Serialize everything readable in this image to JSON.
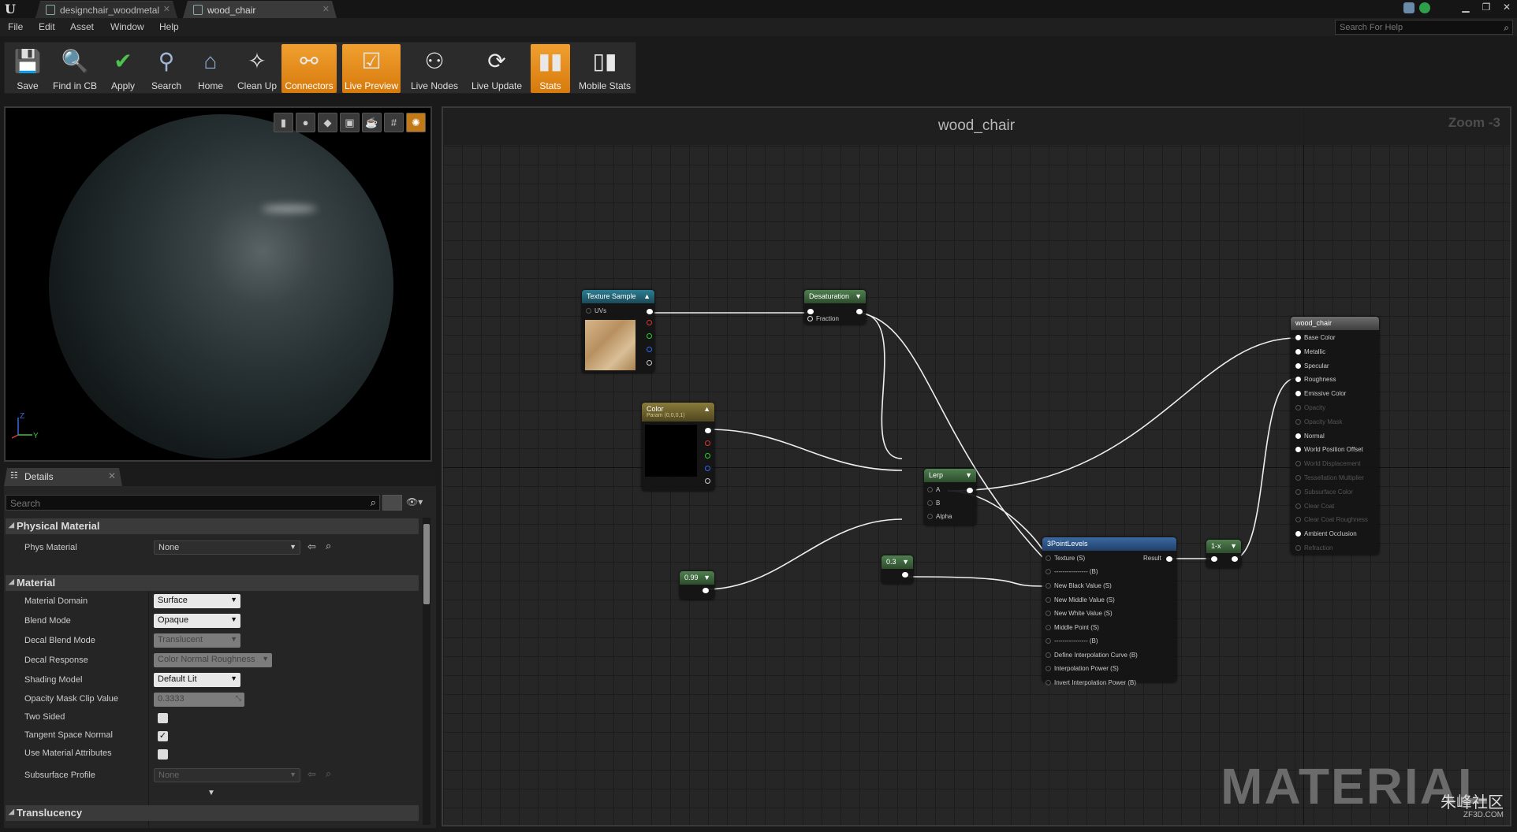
{
  "tabs": [
    {
      "label": "designchair_woodmetal"
    },
    {
      "label": "wood_chair"
    }
  ],
  "menu": [
    "File",
    "Edit",
    "Asset",
    "Window",
    "Help"
  ],
  "help_search": {
    "placeholder": "Search For Help"
  },
  "toolbar": {
    "save": "Save",
    "find_in_cb": "Find in CB",
    "apply": "Apply",
    "search": "Search",
    "home": "Home",
    "clean_up": "Clean Up",
    "connectors": "Connectors",
    "live_preview": "Live Preview",
    "live_nodes": "Live Nodes",
    "live_update": "Live Update",
    "stats": "Stats",
    "mobile_stats": "Mobile Stats"
  },
  "viewport": {
    "axis_z": "Z",
    "axis_y": "Y"
  },
  "details": {
    "tab_label": "Details",
    "search_placeholder": "Search",
    "physical_material": {
      "title": "Physical Material",
      "phys_material_label": "Phys Material",
      "phys_material_value": "None"
    },
    "material": {
      "title": "Material",
      "material_domain_label": "Material Domain",
      "material_domain_value": "Surface",
      "blend_mode_label": "Blend Mode",
      "blend_mode_value": "Opaque",
      "decal_blend_mode_label": "Decal Blend Mode",
      "decal_blend_mode_value": "Translucent",
      "decal_response_label": "Decal Response",
      "decal_response_value": "Color Normal Roughness",
      "shading_model_label": "Shading Model",
      "shading_model_value": "Default Lit",
      "opacity_clip_label": "Opacity Mask Clip Value",
      "opacity_clip_value": "0.3333",
      "two_sided_label": "Two Sided",
      "two_sided_checked": false,
      "tangent_space_label": "Tangent Space Normal",
      "tangent_space_checked": true,
      "use_attr_label": "Use Material Attributes",
      "use_attr_checked": false,
      "subsurface_label": "Subsurface Profile",
      "subsurface_value": "None"
    },
    "translucency": {
      "title": "Translucency"
    }
  },
  "graph": {
    "title": "wood_chair",
    "zoom": "Zoom -3",
    "watermark": "MATERIAL",
    "nodes": {
      "texture_sample": {
        "title": "Texture Sample",
        "pin_uvs": "UVs"
      },
      "desaturation": {
        "title": "Desaturation",
        "pin_fraction": "Fraction"
      },
      "color": {
        "title": "Color",
        "subtitle": "Param (0,0,0,1)"
      },
      "lerp": {
        "title": "Lerp",
        "pin_a": "A",
        "pin_b": "B",
        "pin_alpha": "Alpha"
      },
      "const_099": {
        "title": "0.99"
      },
      "const_03": {
        "title": "0.3"
      },
      "three_point": {
        "title": "3PointLevels",
        "result": "Result",
        "pins": [
          "Texture (S)",
          "---------------- (B)",
          "New Black Value (S)",
          "New Middle Value (S)",
          "New White Value (S)",
          "Middle Point (S)",
          "---------------- (B)",
          "Define Interpolation Curve (B)",
          "Interpolation Power (S)",
          "Invert Interpolation Power (B)"
        ]
      },
      "one_minus": {
        "title": "1-x"
      },
      "result": {
        "title": "wood_chair",
        "pins": [
          "Base Color",
          "Metallic",
          "Specular",
          "Roughness",
          "Emissive Color",
          "Opacity",
          "Opacity Mask",
          "Normal",
          "World Position Offset",
          "World Displacement",
          "Tessellation Multiplier",
          "Subsurface Color",
          "Clear Coat",
          "Clear Coat Roughness",
          "Ambient Occlusion",
          "Refraction"
        ],
        "active": [
          true,
          true,
          true,
          true,
          true,
          false,
          false,
          true,
          true,
          false,
          false,
          false,
          false,
          false,
          true,
          false
        ]
      }
    }
  },
  "footer_logo": {
    "name": "朱峰社区",
    "url": "ZF3D.COM"
  },
  "colors": {
    "accent_orange": "#e38a1c",
    "node_teal": "#2b7d93",
    "node_green": "#4f7f4f"
  }
}
